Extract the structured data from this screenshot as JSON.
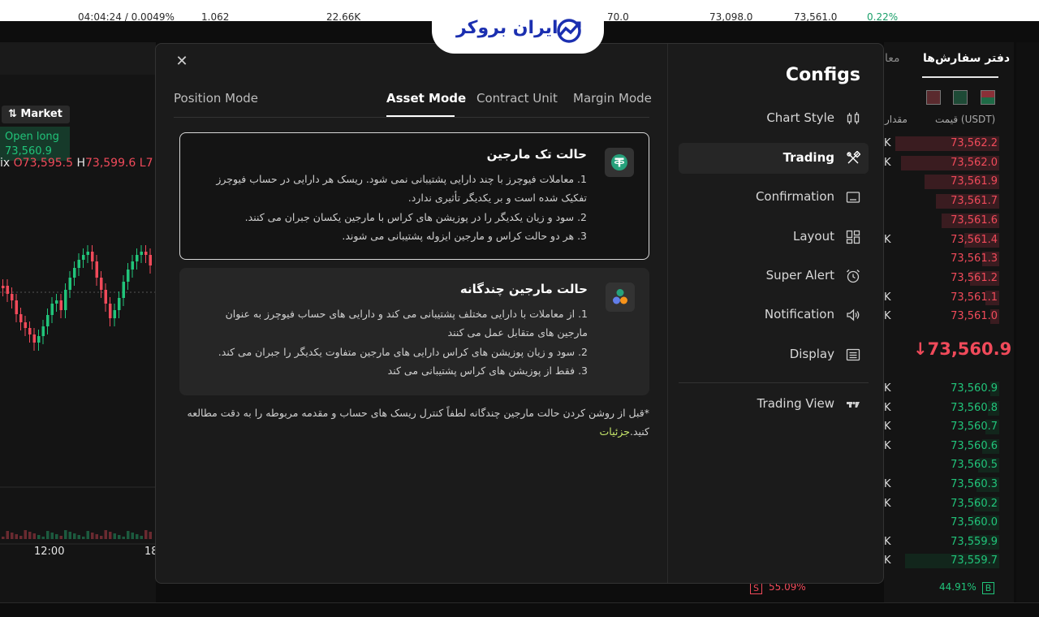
{
  "ticker": {
    "items": [
      "04:04:24 / 0.0049%",
      "1.062",
      "22.66K",
      "70.0",
      "73,098.0",
      "73,561.0",
      "0.22%"
    ]
  },
  "chart": {
    "order_type": "Market",
    "open_long_label": "Open long",
    "open_long_price": "73,560.9",
    "ohlc_prefix": "ix",
    "ohlc_o": "O73,595.5",
    "ohlc_h_label": "H",
    "ohlc_h": "73,599.6",
    "ohlc_l": "L7",
    "time_labels": [
      "12:00",
      "18"
    ]
  },
  "orderbook": {
    "tab_active": "دفتر سفارش‌ها",
    "tab_other": "معا",
    "col_price": "قیمت (USDT)",
    "col_amount": "مقدار",
    "asks": [
      "73,562.2",
      "73,562.0",
      "73,561.9",
      "73,561.7",
      "73,561.6",
      "73,561.4",
      "73,561.3",
      "73,561.2",
      "73,561.1",
      "73,561.0"
    ],
    "last_price": "↓73,560.9",
    "bids": [
      "73,560.9",
      "73,560.8",
      "73,560.7",
      "73,560.6",
      "73,560.5",
      "73,560.3",
      "73,560.2",
      "73,560.0",
      "73,559.9",
      "73,559.7"
    ],
    "sell_ratio": "55.09%",
    "buy_ratio": "44.91%",
    "sell_tag": "S",
    "buy_tag": "B",
    "colors": {
      "ask": "#f04a5a",
      "bid": "#21c47a"
    }
  },
  "logo": {
    "text": "ایران بروکر",
    "color": "#1b2fb0"
  },
  "modal": {
    "close_icon": "close-icon",
    "tabs": [
      "Position Mode",
      "Asset Mode",
      "Contract Unit",
      "Margin Mode"
    ],
    "active_tab": "Asset Mode",
    "cards": [
      {
        "title": "حالت تک مارجین",
        "icon": "tether-icon",
        "lines": [
          "1. معاملات فیوچرز با چند دارایی پشتیبانی نمی شود. ریسک هر دارایی در حساب فیوچرز",
          "تفکیک شده است و بر یکدیگر تأثیری ندارد.",
          "2. سود و زیان یکدیگر را در پوزیشن های کراس با مارجین یکسان جبران می کنند.",
          "3. هر دو حالت کراس و مارجین ایزوله پشتیبانی می شوند."
        ]
      },
      {
        "title": "حالت مارجین چندگانه",
        "icon": "multi-asset-icon",
        "lines": [
          "1. از معاملات با دارایی مختلف پشتیبانی می کند و دارایی های حساب فیوچرز به عنوان",
          "مارجین های متقابل عمل می کنند",
          "2. سود و زیان پوزیشن های کراس دارایی های مارجین متفاوت یکدیگر را جبران می کند.",
          "3. فقط از پوزیشن های کراس پشتیبانی می کند"
        ]
      }
    ],
    "note_text": "*قبل از روشن کردن حالت مارجین چندگانه لطفاً کنترل ریسک های حساب و مقدمه مربوطه را به دقت مطالعه کنید.",
    "note_link": "جزئیات",
    "configs_title": "Configs",
    "menu": [
      {
        "label": "Chart Style",
        "icon": "candles-icon"
      },
      {
        "label": "Trading",
        "icon": "tools-icon"
      },
      {
        "label": "Confirmation",
        "icon": "window-icon"
      },
      {
        "label": "Layout",
        "icon": "grid-icon"
      },
      {
        "label": "Super Alert",
        "icon": "alarm-icon"
      },
      {
        "label": "Notification",
        "icon": "speaker-icon"
      },
      {
        "label": "Display",
        "icon": "display-icon"
      },
      {
        "label": "Trading View",
        "icon": "tradingview-icon"
      }
    ],
    "active_menu": "Trading"
  }
}
